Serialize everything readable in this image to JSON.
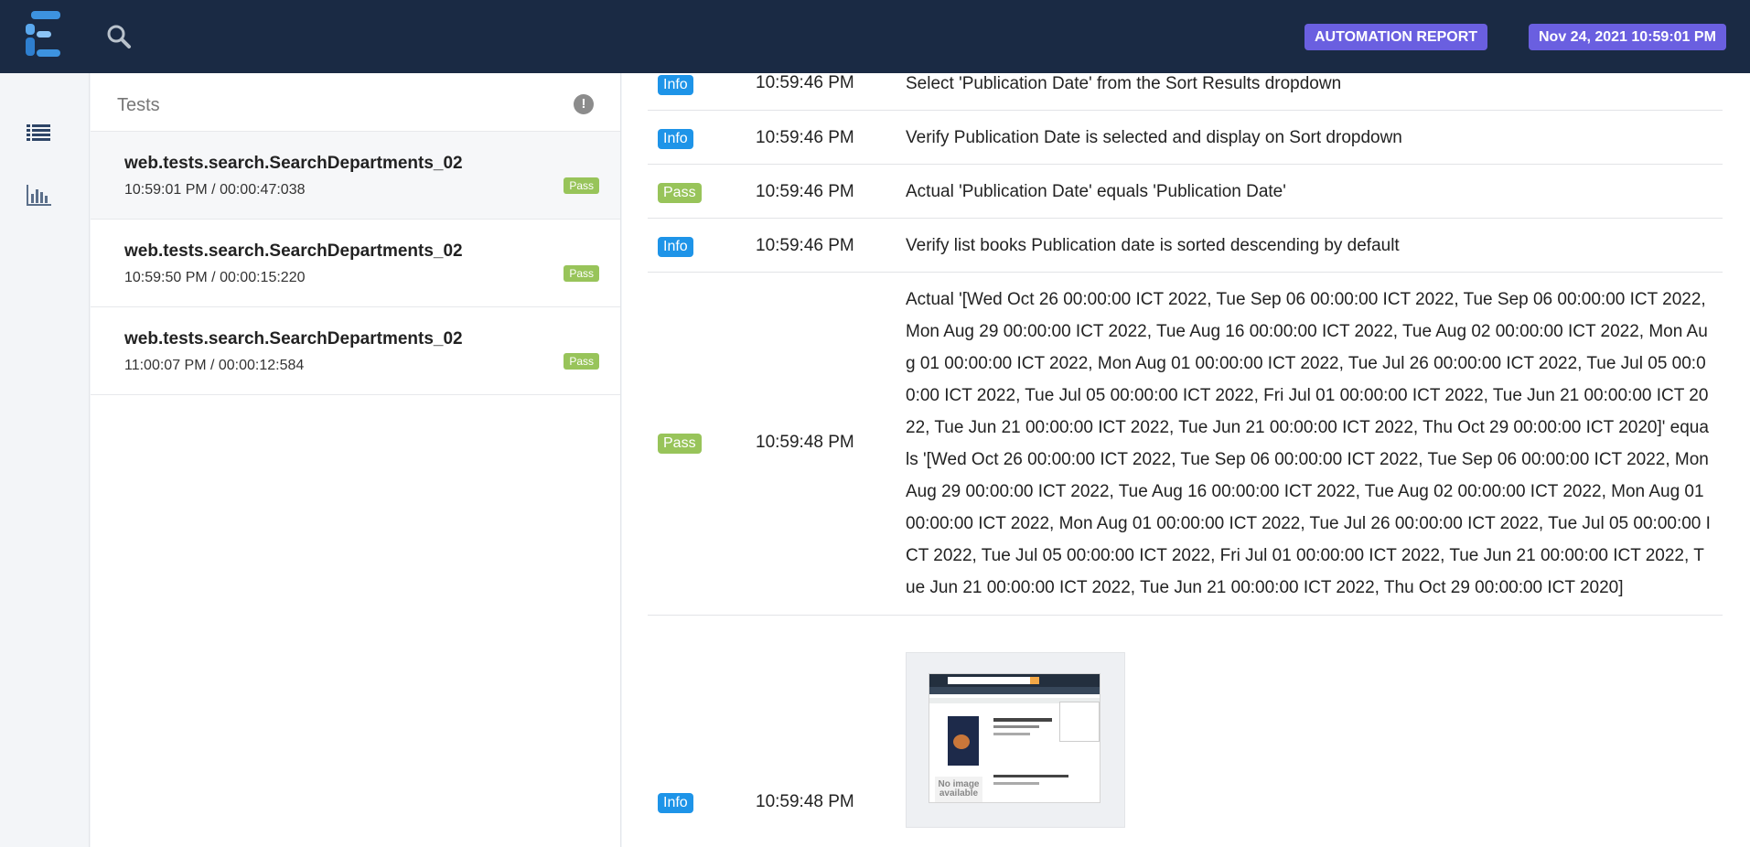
{
  "header": {
    "report_label": "AUTOMATION REPORT",
    "report_datetime": "Nov 24, 2021 10:59:01 PM",
    "accent_color": "#6a5fe0"
  },
  "nav": {
    "icons": [
      "search-icon",
      "list-icon",
      "bar-chart-icon"
    ]
  },
  "tests_panel": {
    "title": "Tests",
    "items": [
      {
        "name": "web.tests.search.SearchDepartments_02",
        "time": "10:59:01 PM / 00:00:47:038",
        "status": "Pass"
      },
      {
        "name": "web.tests.search.SearchDepartments_02",
        "time": "10:59:50 PM / 00:00:15:220",
        "status": "Pass"
      },
      {
        "name": "web.tests.search.SearchDepartments_02",
        "time": "11:00:07 PM / 00:00:12:584",
        "status": "Pass"
      }
    ]
  },
  "logs": [
    {
      "status": "Info",
      "time": "10:59:46 PM",
      "details": "Select 'Publication Date' from the Sort Results dropdown"
    },
    {
      "status": "Info",
      "time": "10:59:46 PM",
      "details": "Verify Publication Date is selected and display on Sort dropdown"
    },
    {
      "status": "Pass",
      "time": "10:59:46 PM",
      "details": "Actual 'Publication Date' equals 'Publication Date'"
    },
    {
      "status": "Info",
      "time": "10:59:46 PM",
      "details": "Verify list books Publication date is sorted descending by default"
    },
    {
      "status": "Pass",
      "time": "10:59:48 PM",
      "details": "Actual '[Wed Oct 26 00:00:00 ICT 2022, Tue Sep 06 00:00:00 ICT 2022, Tue Sep 06 00:00:00 ICT 2022, Mon Aug 29 00:00:00 ICT 2022, Tue Aug 16 00:00:00 ICT 2022, Tue Aug 02 00:00:00 ICT 2022, Mon Aug 01 00:00:00 ICT 2022, Mon Aug 01 00:00:00 ICT 2022, Tue Jul 26 00:00:00 ICT 2022, Tue Jul 05 00:00:00 ICT 2022, Tue Jul 05 00:00:00 ICT 2022, Fri Jul 01 00:00:00 ICT 2022, Tue Jun 21 00:00:00 ICT 2022, Tue Jun 21 00:00:00 ICT 2022, Tue Jun 21 00:00:00 ICT 2022, Thu Oct 29 00:00:00 ICT 2020]' equals '[Wed Oct 26 00:00:00 ICT 2022, Tue Sep 06 00:00:00 ICT 2022, Tue Sep 06 00:00:00 ICT 2022, Mon Aug 29 00:00:00 ICT 2022, Tue Aug 16 00:00:00 ICT 2022, Tue Aug 02 00:00:00 ICT 2022, Mon Aug 01 00:00:00 ICT 2022, Mon Aug 01 00:00:00 ICT 2022, Tue Jul 26 00:00:00 ICT 2022, Tue Jul 05 00:00:00 ICT 2022, Tue Jul 05 00:00:00 ICT 2022, Fri Jul 01 00:00:00 ICT 2022, Tue Jun 21 00:00:00 ICT 2022, Tue Jun 21 00:00:00 ICT 2022, Tue Jun 21 00:00:00 ICT 2022, Thu Oct 29 00:00:00 ICT 2020]"
    },
    {
      "status": "Info",
      "time": "10:59:48 PM",
      "details": "",
      "screenshot": {
        "no_image_text": "No image available"
      }
    }
  ],
  "colors": {
    "topbar": "#1a2a44",
    "info": "#1e94e8",
    "pass": "#98c45a"
  }
}
